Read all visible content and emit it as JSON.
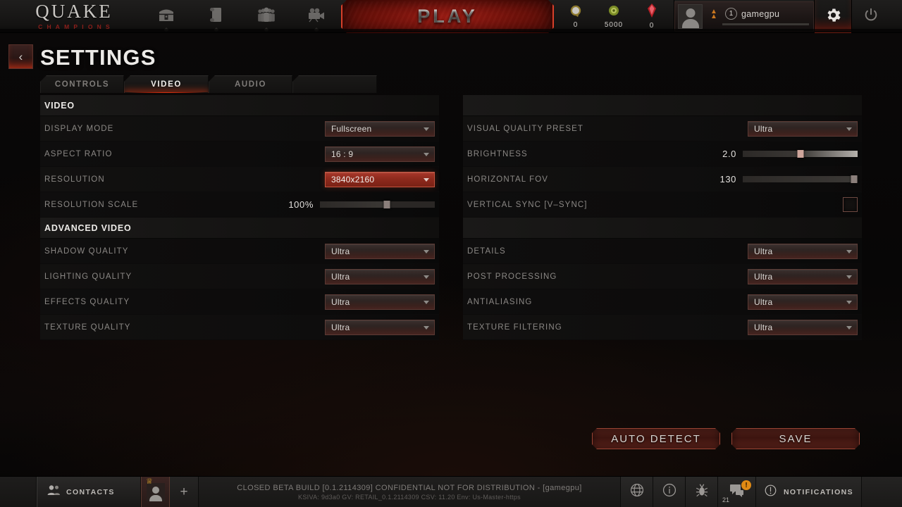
{
  "topbar": {
    "logo": {
      "title": "QUAKE",
      "subtitle": "CHAMPIONS"
    },
    "nav_icons": [
      {
        "name": "loot-chest-icon",
        "label": "Loot"
      },
      {
        "name": "scroll-quests-icon",
        "label": "Quests"
      },
      {
        "name": "champions-icon",
        "label": "Champions"
      },
      {
        "name": "camera-replays-icon",
        "label": "Replays"
      }
    ],
    "play_label": "PLAY",
    "currencies": [
      {
        "name": "shards-currency",
        "value": "0"
      },
      {
        "name": "favor-currency",
        "value": "5000"
      },
      {
        "name": "crystals-currency",
        "value": "0"
      }
    ],
    "profile": {
      "level": "1",
      "name": "gamegpu"
    },
    "settings_icon": "gear-icon",
    "power_icon": "power-icon"
  },
  "header": {
    "back_label": "‹",
    "title": "SETTINGS"
  },
  "tabs": [
    {
      "label": "CONTROLS",
      "active": false
    },
    {
      "label": "VIDEO",
      "active": true
    },
    {
      "label": "AUDIO",
      "active": false
    },
    {
      "label": "",
      "active": false
    }
  ],
  "left_column": {
    "section_video": {
      "title": "VIDEO",
      "rows": [
        {
          "label": "DISPLAY MODE",
          "type": "dropdown",
          "value": "Fullscreen",
          "highlight": false
        },
        {
          "label": "ASPECT RATIO",
          "type": "dropdown",
          "value": "16 : 9",
          "highlight": false
        },
        {
          "label": "RESOLUTION",
          "type": "dropdown",
          "value": "3840x2160",
          "highlight": true
        },
        {
          "label": "RESOLUTION SCALE",
          "type": "slider",
          "value": "100%",
          "percent": 58
        }
      ]
    },
    "section_advanced": {
      "title": "ADVANCED VIDEO",
      "rows": [
        {
          "label": "SHADOW QUALITY",
          "type": "dropdown",
          "value": "Ultra",
          "highlight": false
        },
        {
          "label": "LIGHTING QUALITY",
          "type": "dropdown",
          "value": "Ultra",
          "highlight": false
        },
        {
          "label": "EFFECTS QUALITY",
          "type": "dropdown",
          "value": "Ultra",
          "highlight": false
        },
        {
          "label": "TEXTURE QUALITY",
          "type": "dropdown",
          "value": "Ultra",
          "highlight": false
        }
      ]
    }
  },
  "right_column": {
    "section_top": {
      "title": "",
      "rows": [
        {
          "label": "VISUAL QUALITY PRESET",
          "type": "dropdown",
          "value": "Ultra",
          "highlight": false
        },
        {
          "label": "BRIGHTNESS",
          "type": "slider",
          "value": "2.0",
          "percent": 50
        },
        {
          "label": "HORIZONTAL FOV",
          "type": "slider",
          "value": "130",
          "percent": 97
        },
        {
          "label": "VERTICAL SYNC [V–SYNC]",
          "type": "checkbox",
          "checked": false
        }
      ]
    },
    "section_bottom": {
      "title": "",
      "rows": [
        {
          "label": "DETAILS",
          "type": "dropdown",
          "value": "Ultra",
          "highlight": false
        },
        {
          "label": "POST PROCESSING",
          "type": "dropdown",
          "value": "Ultra",
          "highlight": false
        },
        {
          "label": "ANTIALIASING",
          "type": "dropdown",
          "value": "Ultra",
          "highlight": false
        },
        {
          "label": "TEXTURE FILTERING",
          "type": "dropdown",
          "value": "Ultra",
          "highlight": false
        }
      ]
    }
  },
  "actions": {
    "auto_detect_label": "AUTO DETECT",
    "save_label": "SAVE"
  },
  "bottombar": {
    "contacts_label": "CONTACTS",
    "add_friend_label": "+",
    "build_line1": "CLOSED BETA BUILD [0.1.2114309] CONFIDENTIAL NOT FOR DISTRIBUTION - [gamegpu]",
    "build_line2": "KSIVA: 9d3a0    GV: RETAIL_0.1.2114309    CSV: 11.20 Env: Us-Master-https",
    "icons": [
      {
        "name": "globe-icon"
      },
      {
        "name": "info-icon"
      },
      {
        "name": "bug-report-icon"
      }
    ],
    "chat": {
      "count": "21",
      "badge": "!"
    },
    "notifications_label": "NOTIFICATIONS"
  },
  "colors": {
    "accent_red": "#a8382a",
    "tab_glow": "#ff3b12",
    "text_primary": "#eceae7",
    "text_muted": "#8b8885",
    "badge_orange": "#e08a14"
  }
}
